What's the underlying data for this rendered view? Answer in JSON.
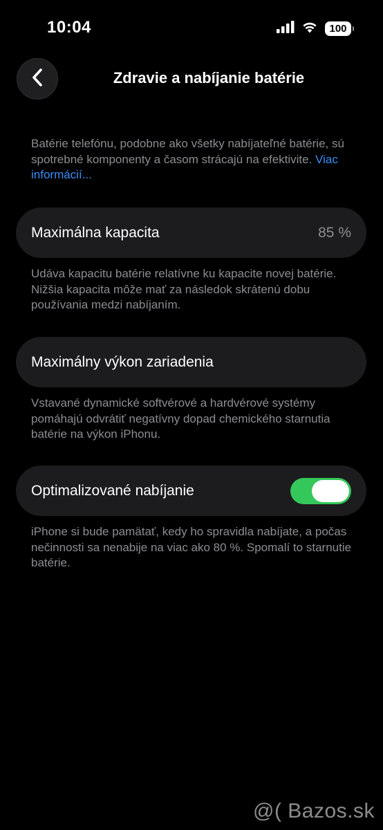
{
  "status_bar": {
    "time": "10:04",
    "battery_level": "100",
    "signal_icon": "signal-bars-icon",
    "wifi_icon": "wifi-icon"
  },
  "nav": {
    "back_icon": "chevron-left-icon",
    "title": "Zdravie a nabíjanie batérie"
  },
  "intro": {
    "text": "Batérie telefónu, podobne ako všetky nabíjateľné batérie, sú spotrebné komponenty a časom strácajú na efektivite. ",
    "link": "Viac informácií..."
  },
  "max_capacity": {
    "label": "Maximálna kapacita",
    "value": "85 %",
    "note": "Udáva kapacitu batérie relatívne ku kapacite novej batérie. Nižšia kapacita môže mať za následok skrátenú dobu používania medzi nabíjaním."
  },
  "peak_performance": {
    "label": "Maximálny výkon zariadenia",
    "note": "Vstavané dynamické softvérové a hardvérové systémy pomáhajú odvrátiť negatívny dopad chemického starnutia batérie na výkon iPhonu."
  },
  "optimized_charging": {
    "label": "Optimalizované nabíjanie",
    "enabled": true,
    "note": "iPhone si bude pamätať, kedy ho spravidla nabíjate, a počas nečinnosti sa nenabije na viac ako 80 %. Spomalí to starnutie batérie."
  },
  "watermark": "@( Bazos.sk",
  "colors": {
    "background": "#000000",
    "card": "#1c1c1e",
    "secondary_text": "#8d8d92",
    "link": "#3a8ef8",
    "toggle_on": "#34c759"
  }
}
